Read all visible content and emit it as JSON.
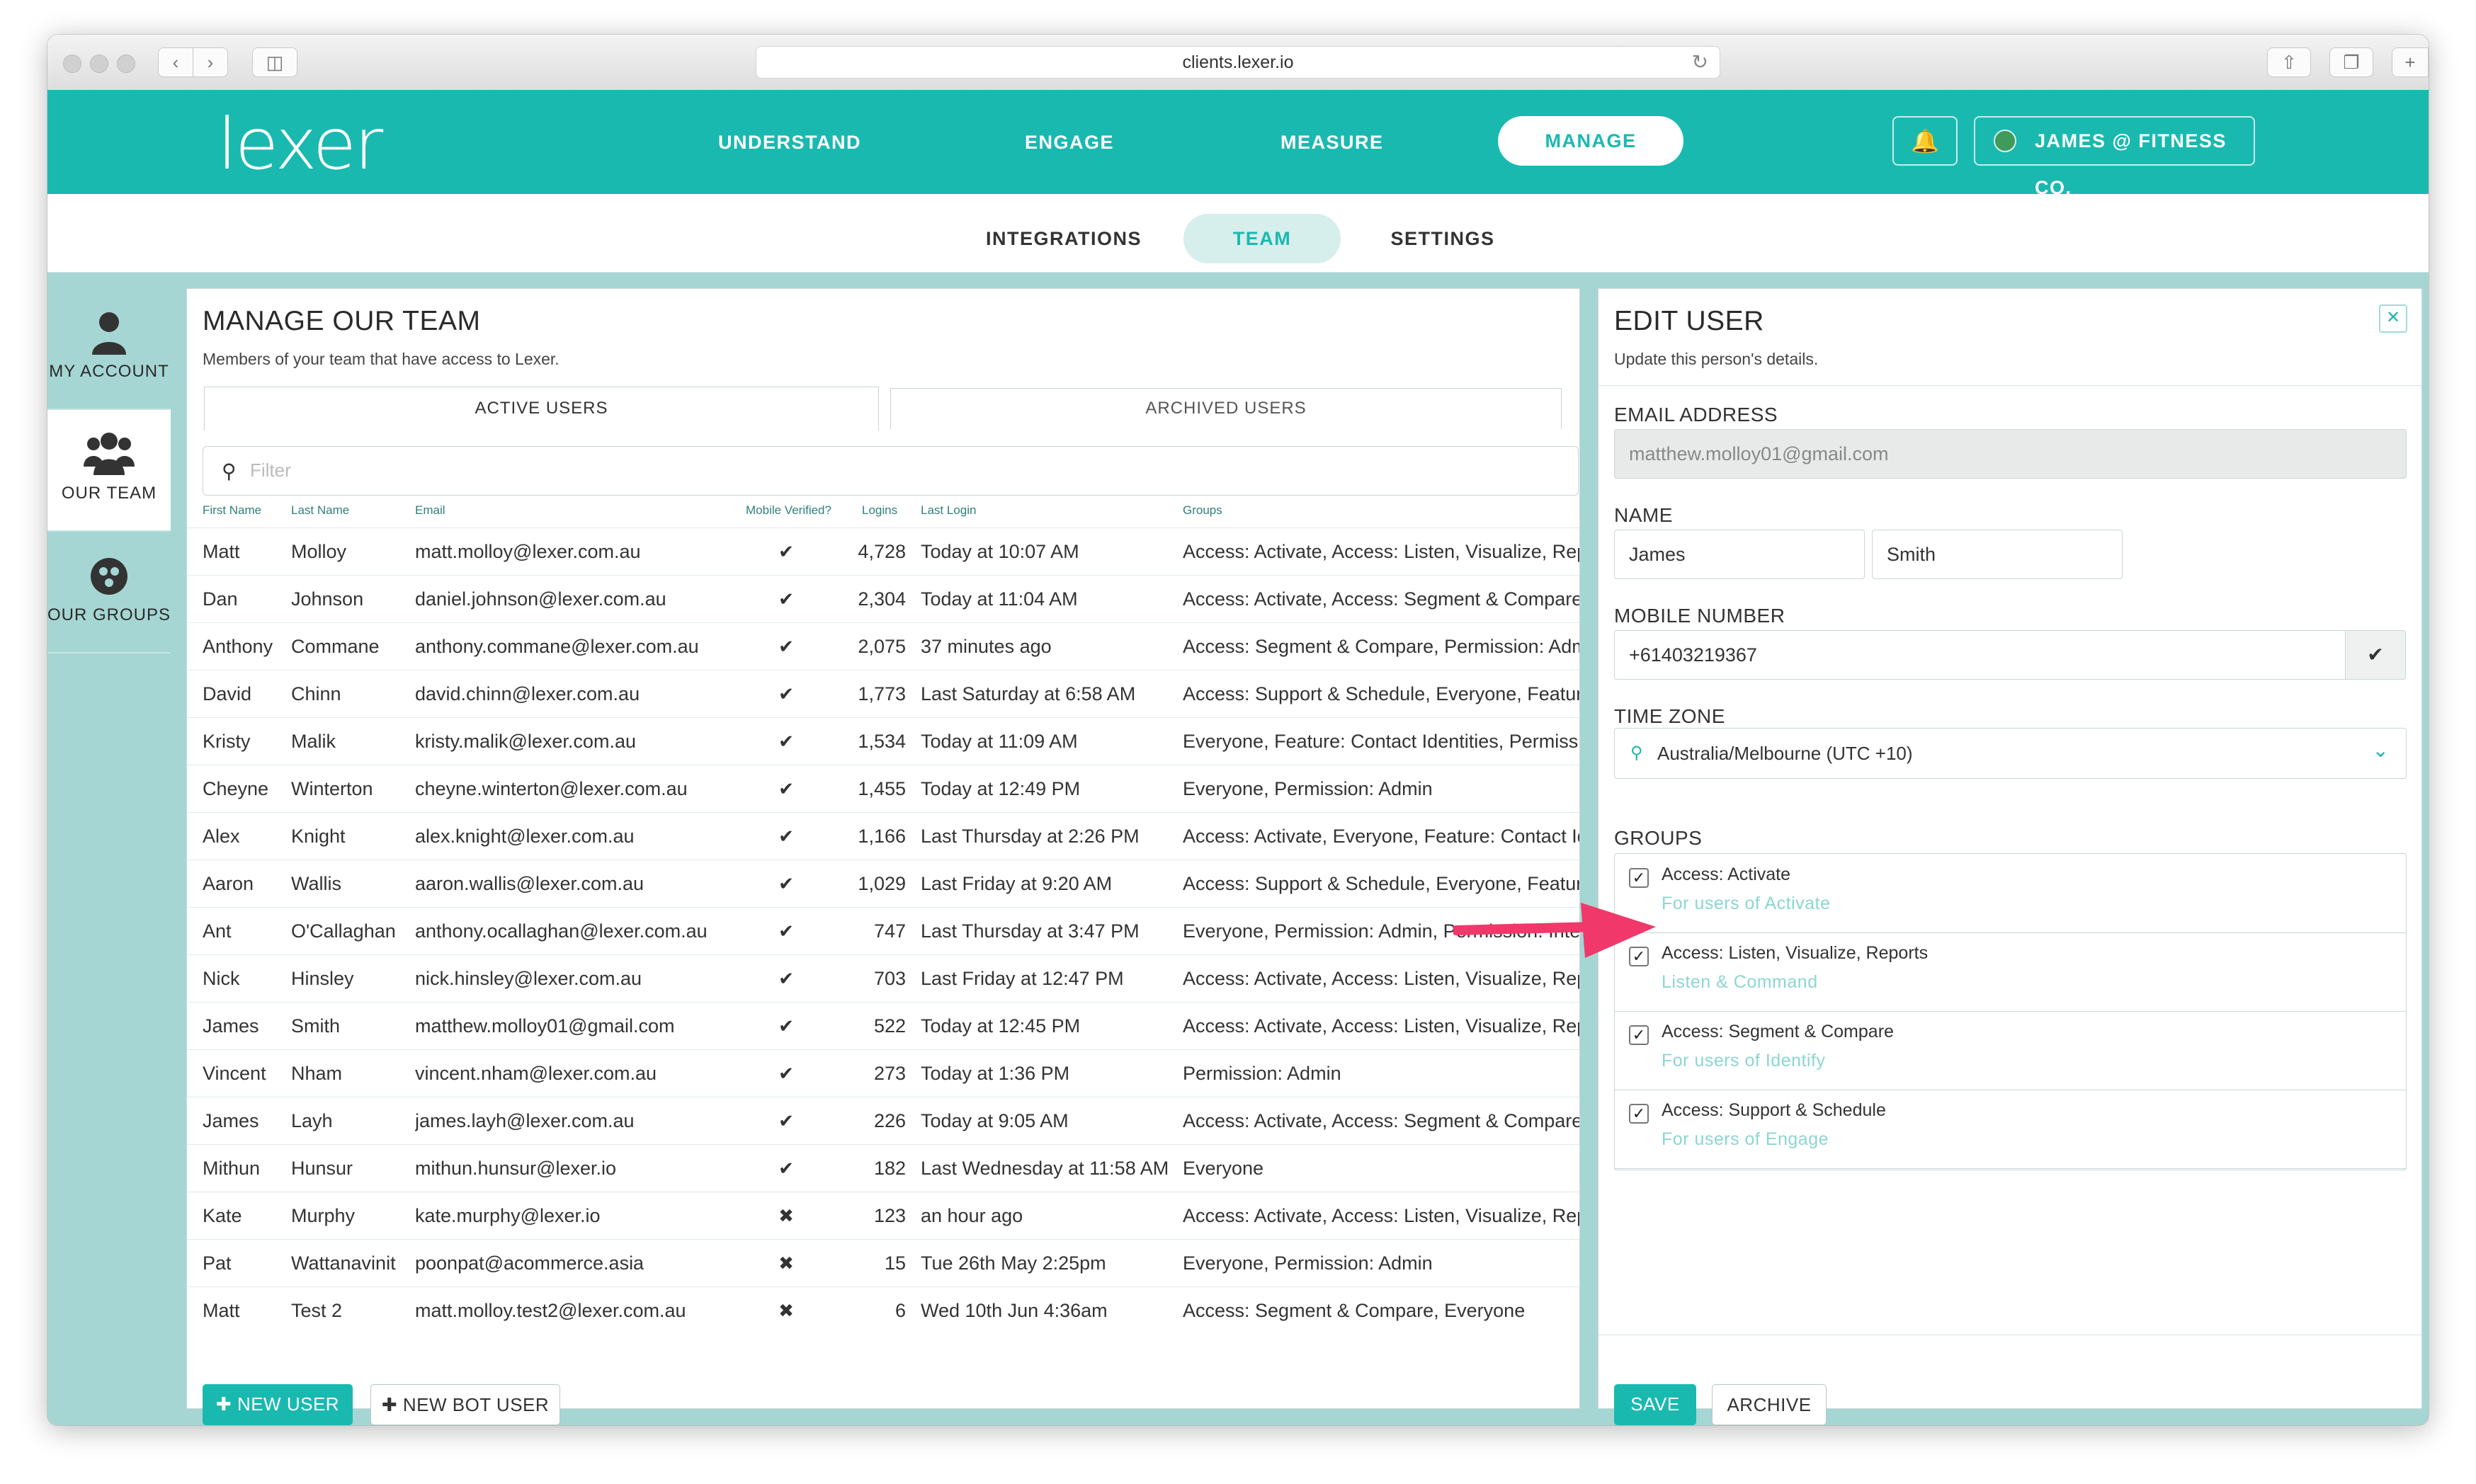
{
  "browser": {
    "url": "clients.lexer.io"
  },
  "brand": {
    "logo": "lexer",
    "accent": "#1ab9b0",
    "sidebar_bg": "#a5d6d3"
  },
  "nav": {
    "understand": "UNDERSTAND",
    "engage": "ENGAGE",
    "measure": "MEASURE",
    "manage": "MANAGE",
    "account": "JAMES @ FITNESS CO."
  },
  "subnav": {
    "integrations": "INTEGRATIONS",
    "team": "TEAM",
    "settings": "SETTINGS"
  },
  "sidebar": {
    "my_account": "MY ACCOUNT",
    "our_team": "OUR TEAM",
    "our_groups": "OUR GROUPS"
  },
  "team": {
    "title": "MANAGE OUR TEAM",
    "subtitle": "Members of your team that have access to Lexer.",
    "tab_active": "ACTIVE USERS",
    "tab_archived": "ARCHIVED USERS",
    "filter_placeholder": "Filter",
    "columns": [
      "First Name",
      "Last Name",
      "Email",
      "Mobile Verified?",
      "Logins",
      "Last Login",
      "Groups"
    ],
    "rows": [
      [
        "Matt",
        "Molloy",
        "matt.molloy@lexer.com.au",
        "✔",
        "4,728",
        "Today at 10:07 AM",
        "Access: Activate, Access: Listen, Visualize, Reports"
      ],
      [
        "Dan",
        "Johnson",
        "daniel.johnson@lexer.com.au",
        "✔",
        "2,304",
        "Today at 11:04 AM",
        "Access: Activate, Access: Segment & Compare, Everyone"
      ],
      [
        "Anthony",
        "Commane",
        "anthony.commane@lexer.com.au",
        "✔",
        "2,075",
        "37 minutes ago",
        "Access: Segment & Compare, Permission: Admin"
      ],
      [
        "David",
        "Chinn",
        "david.chinn@lexer.com.au",
        "✔",
        "1,773",
        "Last Saturday at 6:58 AM",
        "Access: Support & Schedule, Everyone, Feature"
      ],
      [
        "Kristy",
        "Malik",
        "kristy.malik@lexer.com.au",
        "✔",
        "1,534",
        "Today at 11:09 AM",
        "Everyone, Feature: Contact Identities, Permission"
      ],
      [
        "Cheyne",
        "Winterton",
        "cheyne.winterton@lexer.com.au",
        "✔",
        "1,455",
        "Today at 12:49 PM",
        "Everyone, Permission: Admin"
      ],
      [
        "Alex",
        "Knight",
        "alex.knight@lexer.com.au",
        "✔",
        "1,166",
        "Last Thursday at 2:26 PM",
        "Access: Activate, Everyone, Feature: Contact Identities"
      ],
      [
        "Aaron",
        "Wallis",
        "aaron.wallis@lexer.com.au",
        "✔",
        "1,029",
        "Last Friday at 9:20 AM",
        "Access: Support & Schedule, Everyone, Feature"
      ],
      [
        "Ant",
        "O'Callaghan",
        "anthony.ocallaghan@lexer.com.au",
        "✔",
        "747",
        "Last Thursday at 3:47 PM",
        "Everyone, Permission: Admin, Permission: Integrations"
      ],
      [
        "Nick",
        "Hinsley",
        "nick.hinsley@lexer.com.au",
        "✔",
        "703",
        "Last Friday at 12:47 PM",
        "Access: Activate, Access: Listen, Visualize, Reports"
      ],
      [
        "James",
        "Smith",
        "matthew.molloy01@gmail.com",
        "✔",
        "522",
        "Today at 12:45 PM",
        "Access: Activate, Access: Listen, Visualize, Reports"
      ],
      [
        "Vincent",
        "Nham",
        "vincent.nham@lexer.com.au",
        "✔",
        "273",
        "Today at 1:36 PM",
        "Permission: Admin"
      ],
      [
        "James",
        "Layh",
        "james.layh@lexer.com.au",
        "✔",
        "226",
        "Today at 9:05 AM",
        "Access: Activate, Access: Segment & Compare, Everyone"
      ],
      [
        "Mithun",
        "Hunsur",
        "mithun.hunsur@lexer.io",
        "✔",
        "182",
        "Last Wednesday at 11:58 AM",
        "Everyone"
      ],
      [
        "Kate",
        "Murphy",
        "kate.murphy@lexer.io",
        "✖",
        "123",
        "an hour ago",
        "Access: Activate, Access: Listen, Visualize, Reports"
      ],
      [
        "Pat",
        "Wattanavinit",
        "poonpat@acommerce.asia",
        "✖",
        "15",
        "Tue 26th May 2:25pm",
        "Everyone, Permission: Admin"
      ],
      [
        "Matt",
        "Test 2",
        "matt.molloy.test2@lexer.com.au",
        "✖",
        "6",
        "Wed 10th Jun 4:36am",
        "Access: Segment & Compare, Everyone"
      ]
    ],
    "new_user": "NEW USER",
    "new_bot_user": "NEW BOT USER"
  },
  "edit": {
    "title": "EDIT USER",
    "subtitle": "Update this person's details.",
    "email_label": "EMAIL ADDRESS",
    "email_value": "matthew.molloy01@gmail.com",
    "name_label": "NAME",
    "first_name": "James",
    "last_name": "Smith",
    "mobile_label": "MOBILE NUMBER",
    "mobile_value": "+61403219367",
    "tz_label": "TIME ZONE",
    "tz_value": "Australia/Melbourne (UTC +10)",
    "groups_label": "GROUPS",
    "groups": [
      {
        "name": "Access: Activate",
        "desc": "For users of Activate",
        "checked": "✓"
      },
      {
        "name": "Access: Listen, Visualize, Reports",
        "desc": "Listen & Command",
        "checked": "✓"
      },
      {
        "name": "Access: Segment & Compare",
        "desc": "For users of Identify",
        "checked": "✓"
      },
      {
        "name": "Access: Support & Schedule",
        "desc": "For users of Engage",
        "checked": "✓"
      }
    ],
    "save": "SAVE",
    "archive": "ARCHIVE"
  }
}
